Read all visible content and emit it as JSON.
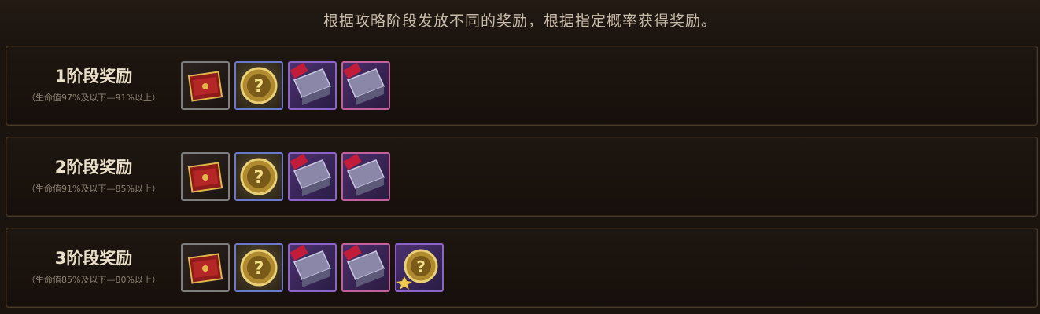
{
  "header": {
    "description": "根据攻略阶段发放不同的奖励，根据指定概率获得奖励。"
  },
  "stages": [
    {
      "title": "1阶段奖励",
      "subtitle": "（生命值97%及以下—91%以上）",
      "rewards": [
        "red-treasure-box-icon",
        "golden-mystery-coin-icon",
        "purple-ribbon-box-icon",
        "pink-ribbon-box-icon"
      ]
    },
    {
      "title": "2阶段奖励",
      "subtitle": "（生命值91%及以下—85%以上）",
      "rewards": [
        "red-treasure-box-icon",
        "golden-mystery-coin-icon",
        "purple-ribbon-box-icon",
        "pink-ribbon-box-icon"
      ]
    },
    {
      "title": "3阶段奖励",
      "subtitle": "（生命值85%及以下—80%以上）",
      "rewards": [
        "red-treasure-box-icon",
        "golden-mystery-coin-icon",
        "purple-ribbon-box-icon",
        "pink-ribbon-box-icon",
        "golden-mystery-coin-sparkle-icon"
      ]
    }
  ],
  "colors": {
    "gray_frame": "#7e7e7e",
    "blue_frame": "#6a79c9",
    "purple_frame": "#8d63c8",
    "pink_frame": "#c0609c"
  }
}
